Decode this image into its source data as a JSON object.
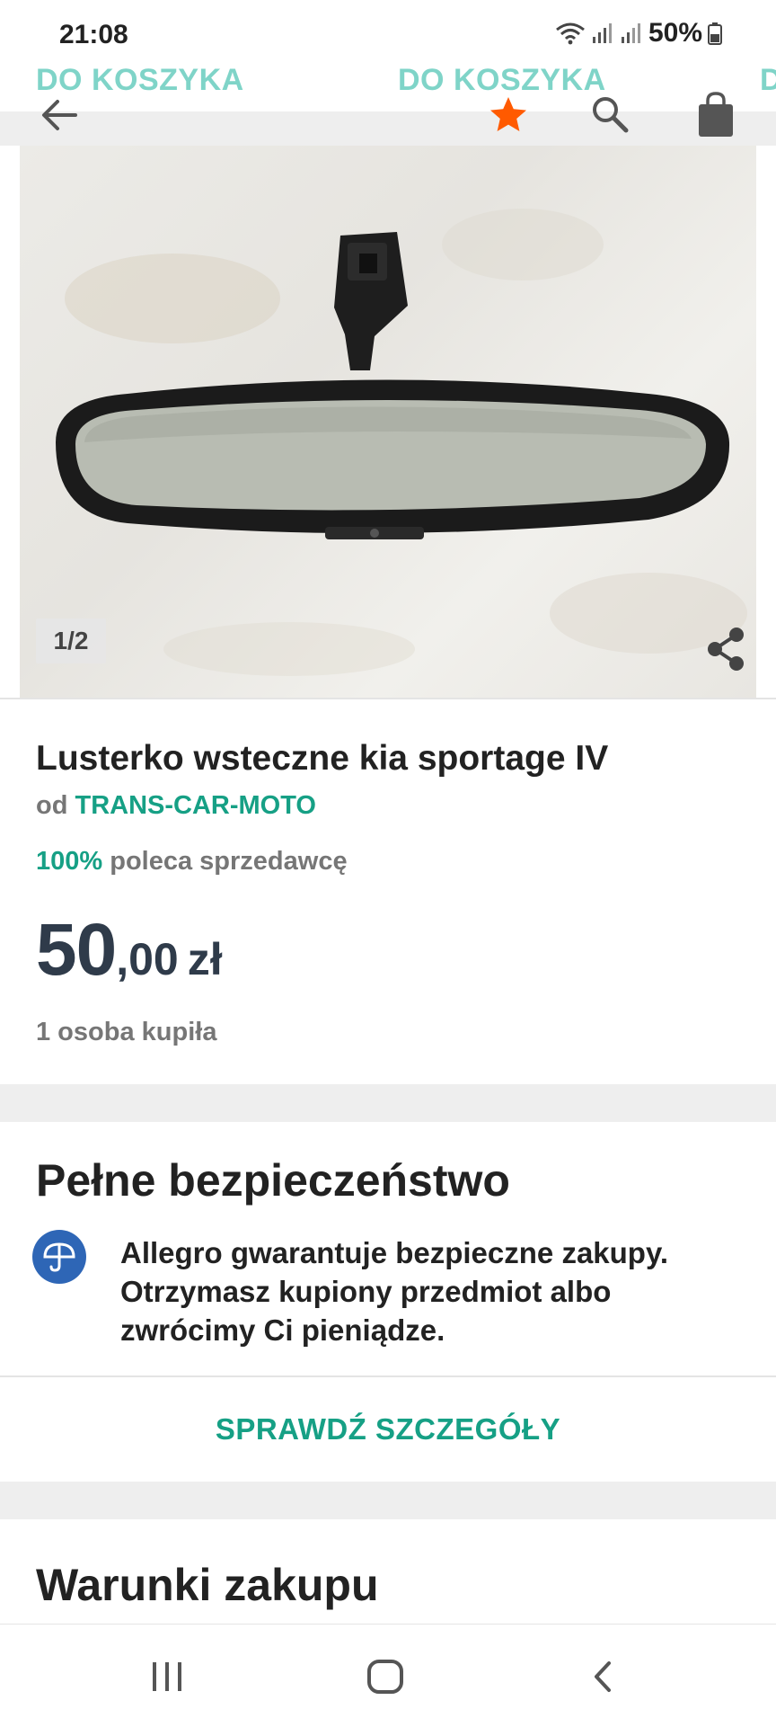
{
  "status_bar": {
    "time": "21:08",
    "battery": "50%",
    "icons": [
      "wifi-icon",
      "signal-icon",
      "signal-icon",
      "battery-icon"
    ]
  },
  "cart_strip": {
    "label_1": "DO KOSZYKA",
    "label_2": "DO KOSZYKA",
    "label_3": "D"
  },
  "app_bar": {
    "icons": [
      "back-arrow-icon",
      "star-icon",
      "search-icon",
      "shopping-bag-icon"
    ],
    "star_color": "#ff5a00"
  },
  "gallery": {
    "counter": "1/2",
    "icons": [
      "share-icon"
    ]
  },
  "product": {
    "title": "Lusterko wsteczne kia sportage IV",
    "seller_prefix": "od",
    "seller_name": "TRANS-CAR-MOTO",
    "recommend_pct": "100%",
    "recommend_text": "poleca sprzedawcę",
    "price_whole": "50",
    "price_fraction": ",00",
    "price_currency": "zł",
    "bought": "1 osoba kupiła"
  },
  "safety": {
    "title": "Pełne bezpieczeństwo",
    "text_line_1": "Allegro gwarantuje bezpieczne zakupy.",
    "text_line_2": "Otrzymasz kupiony przedmiot albo",
    "text_line_3": "zwrócimy Ci pieniądze.",
    "icon": "umbrella-shield-icon",
    "button_label": "SPRAWDŹ SZCZEGÓŁY"
  },
  "purchase_terms": {
    "title": "Warunki zakupu"
  },
  "nav_bar": {
    "icons": [
      "recent-apps-icon",
      "home-icon",
      "back-icon"
    ]
  },
  "colors": {
    "accent": "#16a085",
    "accent_faded": "#7fd4c8",
    "price": "#2f3b4a",
    "shield": "#2e66b6"
  }
}
